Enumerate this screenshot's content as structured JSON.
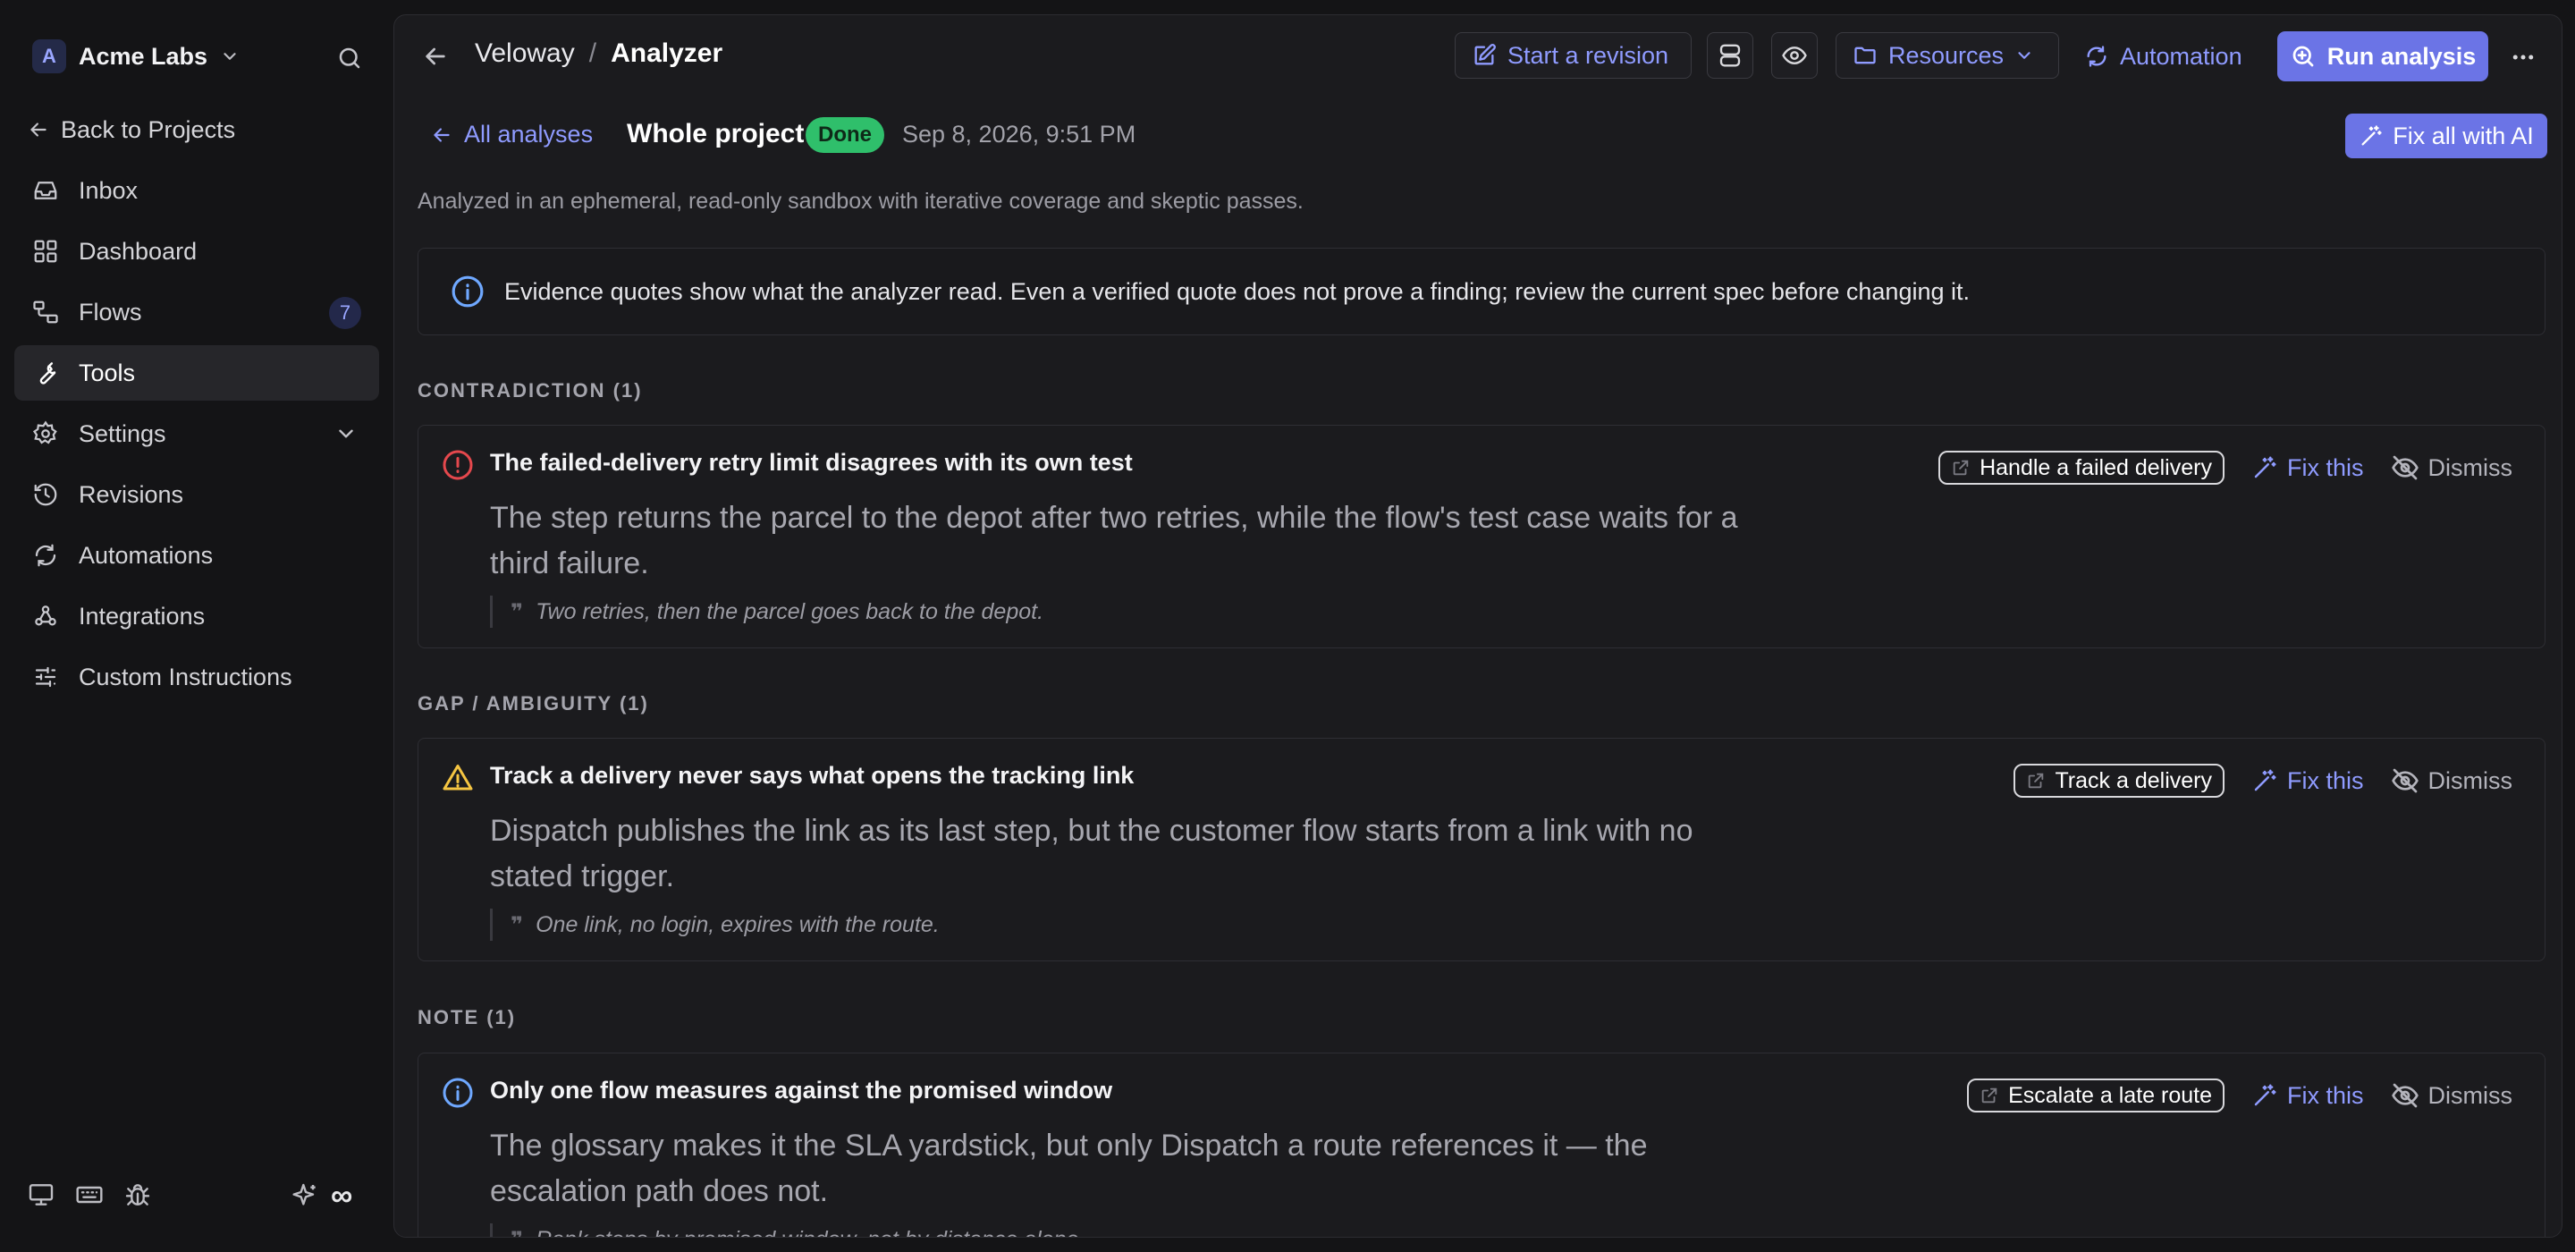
{
  "colors": {
    "accent": "#6b74e6",
    "accent_text": "#8f9bff",
    "done_green": "#2fbf6b",
    "error_red": "#e5484d",
    "warning_yellow": "#f5c542",
    "info_blue": "#6fa8ff"
  },
  "sidebar": {
    "workspace_initial": "A",
    "workspace_name": "Acme Labs",
    "back_label": "Back to Projects",
    "items": [
      {
        "label": "Inbox",
        "icon": "inbox-icon"
      },
      {
        "label": "Dashboard",
        "icon": "dashboard-icon"
      },
      {
        "label": "Flows",
        "icon": "flows-icon",
        "badge": "7"
      },
      {
        "label": "Tools",
        "icon": "wrench-icon",
        "active": true
      },
      {
        "label": "Settings",
        "icon": "gear-icon"
      },
      {
        "label": "Revisions",
        "icon": "history-icon"
      },
      {
        "label": "Automations",
        "icon": "refresh-icon"
      },
      {
        "label": "Integrations",
        "icon": "webhook-icon"
      },
      {
        "label": "Custom Instructions",
        "icon": "sliders-icon"
      }
    ],
    "footer_infinity": "∞"
  },
  "header": {
    "crumb_project": "Veloway",
    "crumb_separator": "/",
    "crumb_page": "Analyzer",
    "start_revision": "Start a revision",
    "resources": "Resources",
    "automation": "Automation",
    "run_analysis": "Run analysis"
  },
  "analysis": {
    "all_analyses": "All analyses",
    "scope": "Whole project",
    "status": "Done",
    "date": "Sep 8, 2026, 9:51 PM",
    "fix_all": "Fix all with AI",
    "description": "Analyzed in an ephemeral, read-only sandbox with iterative coverage and skeptic passes.",
    "info": "Evidence quotes show what the analyzer read. Even a verified quote does not prove a finding; review the current spec before changing it."
  },
  "actions": {
    "fix_this": "Fix this",
    "dismiss": "Dismiss"
  },
  "sections": [
    {
      "label": "CONTRADICTION (1)",
      "severity": "error",
      "title": "The failed-delivery retry limit disagrees with its own test",
      "body": "The step returns the parcel to the depot after two retries, while the flow's test case waits for a third failure.",
      "quote": "Two retries, then the parcel goes back to the depot.",
      "link": "Handle a failed delivery"
    },
    {
      "label": "GAP / AMBIGUITY (1)",
      "severity": "warning",
      "title": "Track a delivery never says what opens the tracking link",
      "body": "Dispatch publishes the link as its last step, but the customer flow starts from a link with no stated trigger.",
      "quote": "One link, no login, expires with the route.",
      "link": "Track a delivery"
    },
    {
      "label": "NOTE (1)",
      "severity": "info",
      "title": "Only one flow measures against the promised window",
      "body": "The glossary makes it the SLA yardstick, but only Dispatch a route references it — the escalation path does not.",
      "quote": "Rank stops by promised window, not by distance alone.",
      "link": "Escalate a late route"
    }
  ]
}
